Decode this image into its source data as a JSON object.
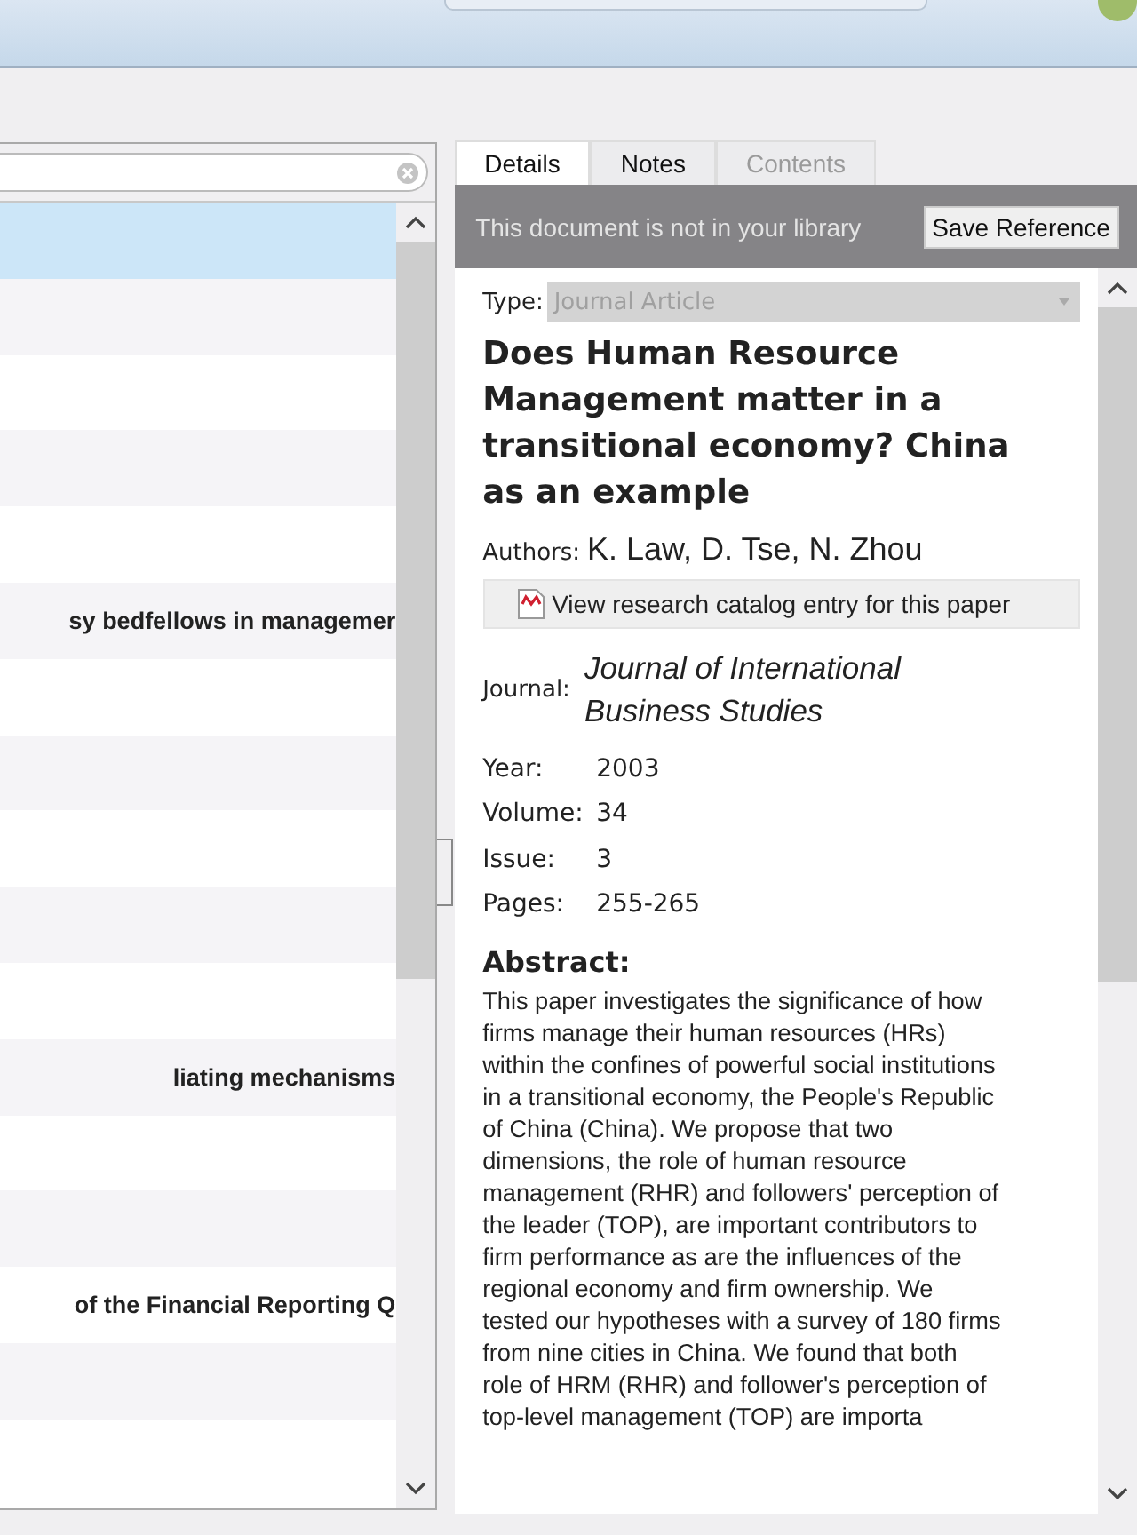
{
  "search": {
    "clear_icon": true
  },
  "list": {
    "rows": [
      {
        "selected": true
      },
      {
        "selected": false
      },
      {
        "selected": false
      },
      {
        "selected": false
      },
      {
        "selected": false
      },
      {
        "selected": false,
        "title": "sy bedfellows in managemer"
      },
      {
        "selected": false
      },
      {
        "selected": false
      },
      {
        "selected": false
      },
      {
        "selected": false
      },
      {
        "selected": false
      },
      {
        "selected": false,
        "title": "liating mechanisms"
      },
      {
        "selected": false
      },
      {
        "selected": false
      },
      {
        "selected": false,
        "title": "of the Financial Reporting Q"
      },
      {
        "selected": false
      },
      {
        "selected": false
      }
    ]
  },
  "tabs": [
    {
      "label": "Details",
      "selected": true,
      "disabled": false
    },
    {
      "label": "Notes",
      "selected": false,
      "disabled": false
    },
    {
      "label": "Contents",
      "selected": false,
      "disabled": true
    }
  ],
  "banner": {
    "message": "This document is not in your library",
    "button": "Save Reference"
  },
  "details": {
    "type_label": "Type:",
    "type_value": "Journal Article",
    "title": "Does Human Resource Management matter in a transitional economy? China as an example",
    "authors_label": "Authors:",
    "authors": "K. Law, D. Tse, N. Zhou",
    "catalog_button": "View research catalog entry for this paper",
    "journal_label": "Journal:",
    "journal": "Journal of International Business Studies",
    "fields": [
      {
        "label": "Year:",
        "value": "2003"
      },
      {
        "label": "Volume:",
        "value": "34"
      },
      {
        "label": "Issue:",
        "value": "3"
      },
      {
        "label": "Pages:",
        "value": "255-265"
      }
    ],
    "abstract_heading": "Abstract:",
    "abstract": "This paper investigates the significance of how firms manage their human resources (HRs) within the confines of powerful social institutions in a transitional economy, the People's Republic of China (China). We propose that two dimensions, the role of human resource management (RHR) and followers' perception of the leader (TOP), are important contributors to firm performance as are the influences of the regional economy and firm ownership. We tested our hypotheses with a survey of 180 firms from nine cities in China. We found that both role of HRM (RHR) and follower's perception of top-level management (TOP) are importa"
  }
}
